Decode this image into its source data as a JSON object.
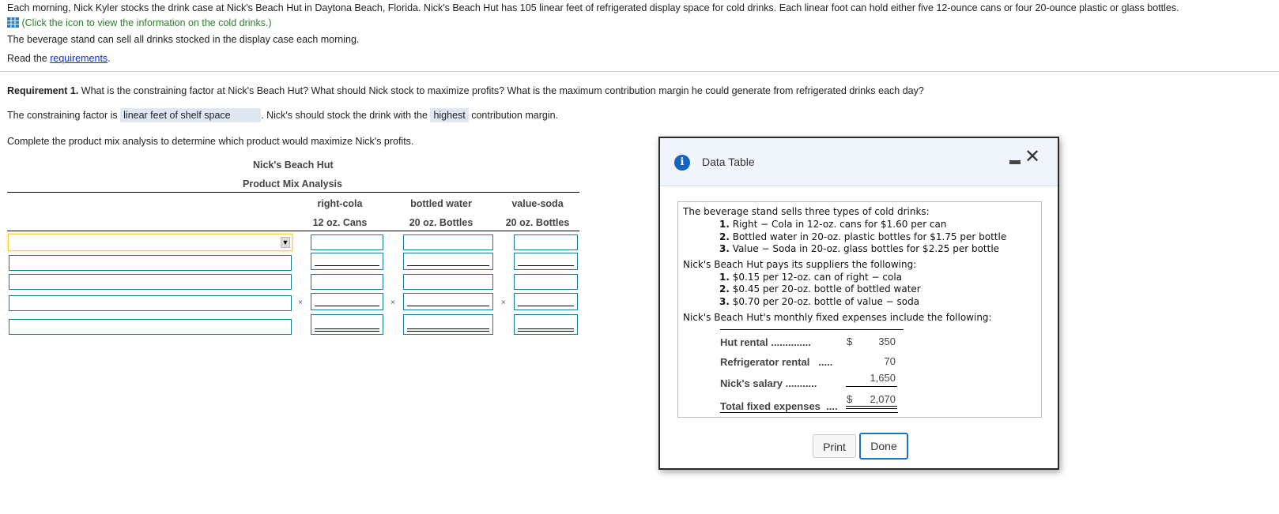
{
  "intro": {
    "line1": "Each morning, Nick Kyler stocks the drink case at Nick's Beach Hut in Daytona Beach, Florida. Nick's Beach Hut has 105 linear feet of refrigerated display space for cold drinks. Each linear foot can hold either five 12-ounce cans or four 20-ounce plastic or glass bottles.",
    "click_icon_text": "(Click the icon to view the information on the cold drinks.)",
    "line3": "The beverage stand can sell all drinks stocked in the display case each morning.",
    "read_prefix": "Read the ",
    "read_link": "requirements",
    "read_suffix": "."
  },
  "requirement": {
    "label": "Requirement 1.",
    "question": " What is the constraining factor at Nick's Beach Hut? What should Nick stock to maximize profits? What is the maximum contribution margin he could generate from refrigerated drinks each day?",
    "constraint_prefix": "The constraining factor is",
    "constraint_value": "linear feet of shelf space",
    "stock_prefix": ". Nick's should stock the drink with the",
    "stock_value": "highest",
    "stock_suffix": "contribution margin.",
    "instruction": "Complete the product mix analysis to determine which product would maximize Nick's profits."
  },
  "product_mix": {
    "title1": "Nick's Beach Hut",
    "title2": "Product Mix Analysis",
    "columns": [
      {
        "name": "right-cola",
        "unit": "12 oz. Cans"
      },
      {
        "name": "bottled water",
        "unit": "20 oz. Bottles"
      },
      {
        "name": "value-soda",
        "unit": "20 oz. Bottles"
      }
    ],
    "rows": [
      {
        "label_value": "",
        "values": [
          "",
          "",
          ""
        ]
      },
      {
        "label_value": "",
        "values": [
          "",
          "",
          ""
        ]
      },
      {
        "label_value": "",
        "values": [
          "",
          "",
          ""
        ]
      },
      {
        "label_value": "",
        "values": [
          "",
          "",
          ""
        ]
      },
      {
        "label_value": "",
        "values": [
          "",
          "",
          ""
        ]
      }
    ],
    "times_symbol": "×",
    "dropdown_arrow": "▼"
  },
  "dialog": {
    "title": "Data Table",
    "minimize_symbol": "–",
    "close_symbol": "✕",
    "info_symbol": "i",
    "sells_intro": "The beverage stand sells three types of cold drinks:",
    "sells_items": [
      {
        "num": "1.",
        "text": " Right − Cola in 12-oz. cans for $1.60 per can"
      },
      {
        "num": "2.",
        "text": " Bottled water in 20-oz. plastic bottles for $1.75 per bottle"
      },
      {
        "num": "3.",
        "text": " Value − Soda in 20-oz. glass bottles for $2.25 per bottle"
      }
    ],
    "pays_intro": "Nick's Beach Hut pays its suppliers the following:",
    "pays_items": [
      {
        "num": "1.",
        "text": " $0.15 per 12-oz. can of right − cola"
      },
      {
        "num": "2.",
        "text": " $0.45 per 20-oz. bottle of bottled water"
      },
      {
        "num": "3.",
        "text": " $0.70 per 20-oz. bottle of value − soda"
      }
    ],
    "fixed_intro": "Nick's Beach Hut's monthly fixed expenses include the following:",
    "fixed_items": [
      {
        "label": "Hut rental",
        "dots": "..............",
        "dollar": "$",
        "value": "350"
      },
      {
        "label": "Refrigerator rental",
        "dots": ".....",
        "dollar": "",
        "value": "70"
      },
      {
        "label": "Nick's salary",
        "dots": "...........",
        "dollar": "",
        "value": "1,650"
      }
    ],
    "total": {
      "label": "Total fixed expenses",
      "dots": "....",
      "dollar": "$",
      "value": "2,070"
    },
    "print_label": "Print",
    "done_label": "Done"
  }
}
